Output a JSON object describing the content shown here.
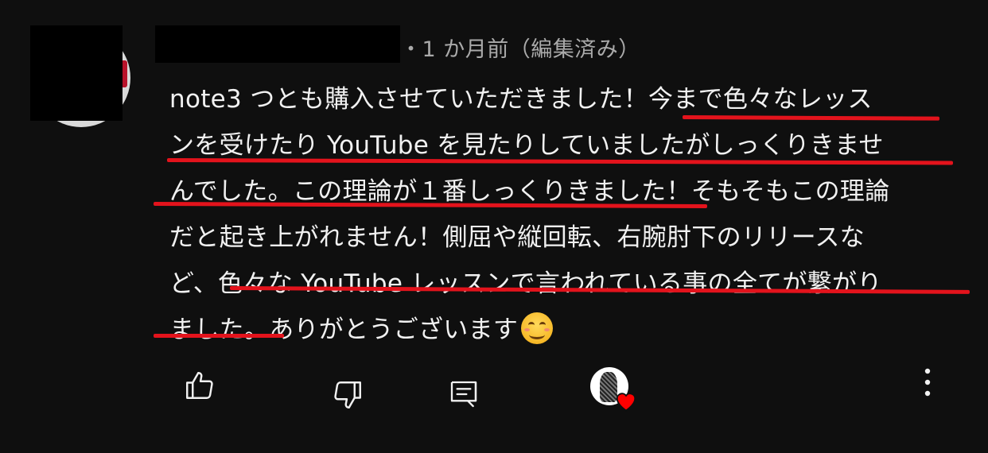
{
  "comment": {
    "meta": "・1 か月前（編集済み）",
    "lines": [
      "note3 つとも購入させていただきました！今まで色々なレッス",
      "ンを受けたり YouTube を見たりしていましたがしっくりきませ",
      "んでした。この理論が１番しっくりきました！そもそもこの理論",
      "だと起き上がれません！側屈や縦回転、右腕肘下のリリースな",
      "ど、色々な YouTube レッスンで言われている事の全てが繋がり",
      "ました。ありがとうございます"
    ],
    "emoji": "smiling-face-with-smiling-eyes",
    "underline_color": "#e3131c",
    "text_color": "#f1f1f1",
    "meta_color": "#aaaaaa",
    "background": "#0f0f0f"
  },
  "actions": {
    "like_icon": "thumbs-up-icon",
    "dislike_icon": "thumbs-down-icon",
    "reply_icon": "reply-comment-icon",
    "creator_heart_icon": "creator-heart-icon",
    "more_icon": "more-vertical-icon",
    "heart_color": "#ff0000"
  }
}
